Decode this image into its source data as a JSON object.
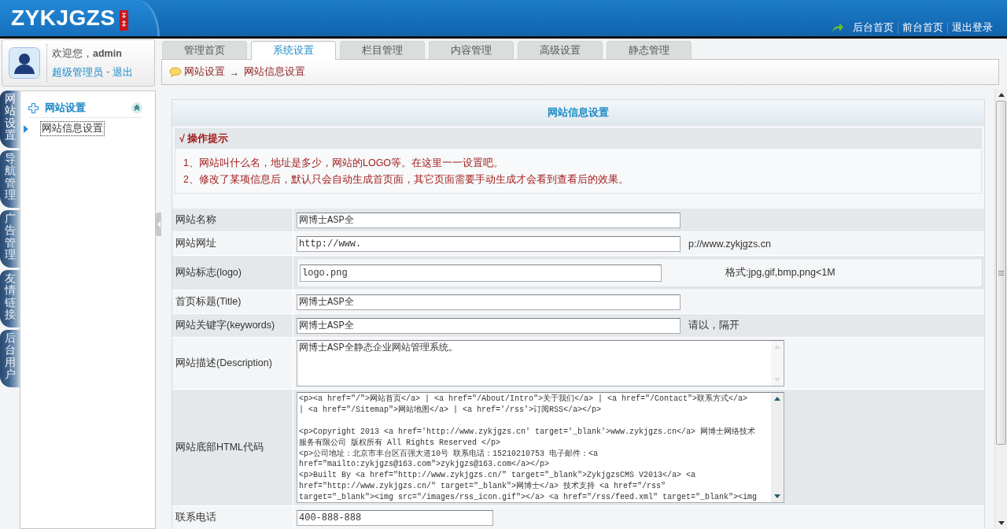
{
  "header": {
    "logo": "ZYKJGZS",
    "links": [
      "后台首页",
      "前台首页",
      "退出登录"
    ]
  },
  "user": {
    "greeting": "欢迎您，**admin**",
    "role": "超级管理员",
    "separator": "-",
    "logout": "退出"
  },
  "tabs": [
    {
      "label": "管理首页",
      "selected": false
    },
    {
      "label": "系统设置",
      "selected": true
    },
    {
      "label": "栏目管理",
      "selected": false
    },
    {
      "label": "内容管理",
      "selected": false
    },
    {
      "label": "高级设置",
      "selected": false
    },
    {
      "label": "静态管理",
      "selected": false
    }
  ],
  "breadcrumb": {
    "items": [
      "网站设置",
      "网站信息设置"
    ],
    "separator": "→"
  },
  "side_tabs": [
    {
      "label": "网站设置",
      "selected": true
    },
    {
      "label": "导航管理",
      "selected": false
    },
    {
      "label": "广告管理",
      "selected": false
    },
    {
      "label": "友情链接",
      "selected": false
    },
    {
      "label": "后台用户",
      "selected": false
    }
  ],
  "sidebar": {
    "title": "网站设置",
    "expanded": true,
    "items": [
      {
        "label": "网站信息设置",
        "selected": true
      }
    ]
  },
  "panel": {
    "title": "网站信息设置",
    "tips": {
      "title": "√ 操作提示",
      "lines": [
        "1、网站叫什么名，地址是多少，网站的LOGO等。在这里一一设置吧。",
        "2、修改了某项信息后，默认只会自动生成首页面，其它页面需要手动生成才会看到查看后的效果。"
      ]
    }
  },
  "form": {
    "rows": [
      {
        "label": "网站名称",
        "kind": "input",
        "value": "网博士ASP全"
      },
      {
        "label": "网站网址",
        "kind": "input",
        "value": "http://www.",
        "hint": "p://www.zykjgzs.cn"
      },
      {
        "label": "网站标志(logo)",
        "kind": "upload",
        "value": "logo.png",
        "hint": "格式:jpg,gif,bmp,png<1M"
      },
      {
        "label": "首页标题(Title)",
        "kind": "input",
        "value": "网博士ASP全"
      },
      {
        "label": "网站关键字(keywords)",
        "kind": "input",
        "value": "网博士ASP全",
        "hint": "请以，隔开"
      },
      {
        "label": "网站描述(Description)",
        "kind": "textarea",
        "value": "网博士ASP全静态企业网站管理系统。"
      },
      {
        "label": "网站底部HTML代码",
        "kind": "code",
        "value": "<p><a href=\"/\">网站首页</a> | <a href=\"/About/Intro\">关于我们</a> | <a href=\"/Contact\">联系方式</a>\n| <a href=\"/Sitemap\">网站地图</a> | <a href='/rss'>订阅RSS</a></p>\n\n<p>Copyright 2013 <a href='http://www.zykjgzs.cn' target='_blank'>www.zykjgzs.cn</a> 网博士网络技术服务有限公司 版权所有 All Rights Reserved </p>\n<p>公司地址：北京市丰台区百强大道10号 联系电话：15210210753 电子邮件：<a\nhref=\"mailto:zykjgzs@163.com\">zykjgzs@163.com</a></p>\n<p>Built By <a href=\"http://www.zykjgzs.cn/\" target=\"_blank\">ZykjgzsCMS V2013</a> <a\nhref=\"http://www.zykjgzs.cn/\" target=\"_blank\">网博士</a> 技术支持 <a href=\"/rss\"\ntarget=\"_blank\"><img src=\"/images/rss_icon.gif\"></a> <a href=\"/rss/feed.xml\" target=\"_blank\"><img"
      },
      {
        "label": "联系电话",
        "kind": "short",
        "value": "400-888-888"
      }
    ]
  }
}
